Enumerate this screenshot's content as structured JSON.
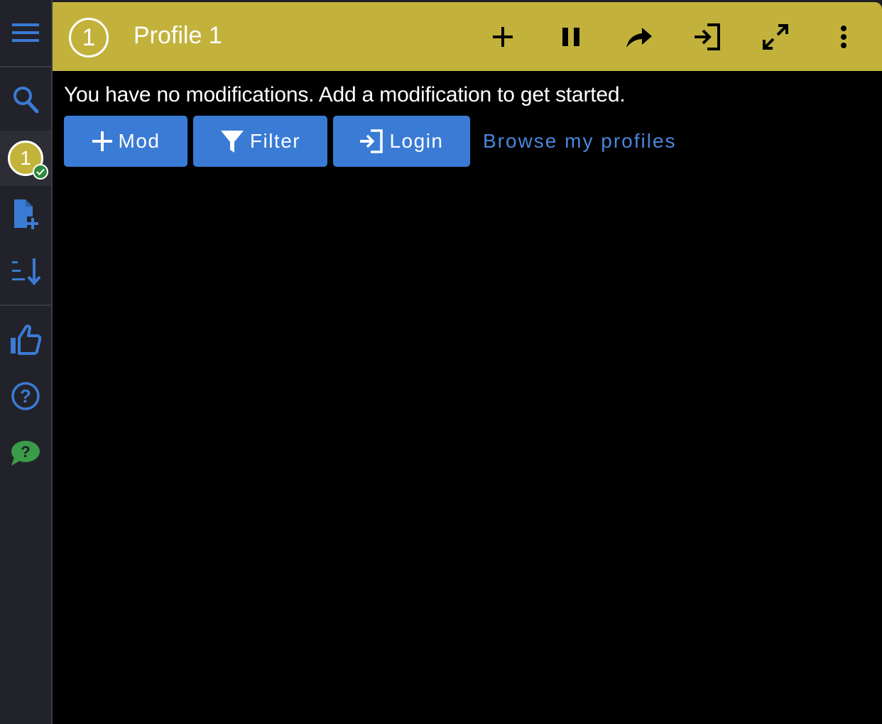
{
  "sidebar": {
    "icons": [
      "menu-icon",
      "search-icon",
      "profile-badge",
      "new-file-icon",
      "sort-icon",
      "thumbs-up-icon",
      "help-icon",
      "chat-help-icon"
    ],
    "profile_number": "1",
    "accent": "#3a7bd5"
  },
  "header": {
    "profile_number": "1",
    "title": "Profile 1",
    "color": "#c2b23c",
    "actions": [
      "add-icon",
      "pause-icon",
      "share-icon",
      "login-icon",
      "expand-icon",
      "more-icon"
    ]
  },
  "main": {
    "message": "You have no modifications. Add a modification to get started.",
    "buttons": {
      "mod": "Mod",
      "filter": "Filter",
      "login": "Login"
    },
    "browse_link": "Browse my profiles"
  }
}
